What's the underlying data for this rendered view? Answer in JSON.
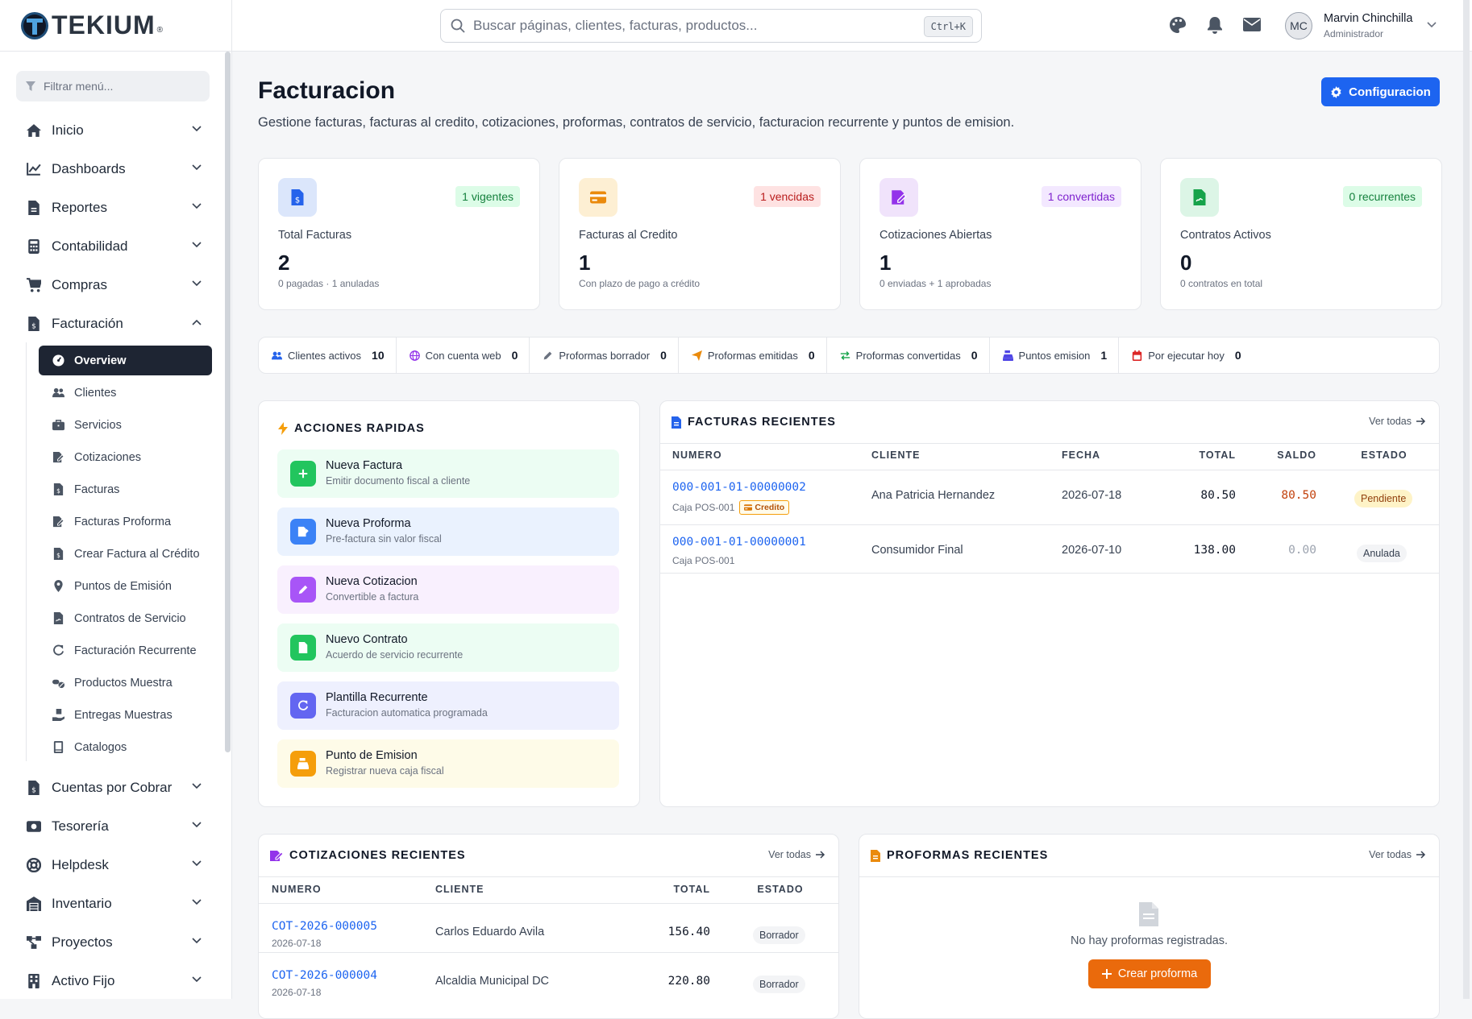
{
  "brand": {
    "logo_text": "TEKIUM",
    "logo_mark": "®"
  },
  "sidebar": {
    "filter_placeholder": "Filtrar menú...",
    "menu": [
      {
        "label": "Inicio",
        "icon": "home-icon"
      },
      {
        "label": "Dashboards",
        "icon": "chart-line-icon"
      },
      {
        "label": "Reportes",
        "icon": "file-icon"
      },
      {
        "label": "Contabilidad",
        "icon": "calculator-icon"
      },
      {
        "label": "Compras",
        "icon": "cart-icon"
      },
      {
        "label": "Facturación",
        "icon": "invoice-icon",
        "expanded": true
      }
    ],
    "submenu": [
      {
        "label": "Overview",
        "icon": "gauge-icon",
        "active": true
      },
      {
        "label": "Clientes",
        "icon": "users-icon"
      },
      {
        "label": "Servicios",
        "icon": "briefcase-icon"
      },
      {
        "label": "Cotizaciones",
        "icon": "edit-file-icon"
      },
      {
        "label": "Facturas",
        "icon": "invoice-icon"
      },
      {
        "label": "Facturas Proforma",
        "icon": "edit-file-icon"
      },
      {
        "label": "Crear Factura al Crédito",
        "icon": "invoice-icon"
      },
      {
        "label": "Puntos de Emisión",
        "icon": "pin-icon"
      },
      {
        "label": "Contratos de Servicio",
        "icon": "contract-icon"
      },
      {
        "label": "Facturación Recurrente",
        "icon": "refresh-icon"
      },
      {
        "label": "Productos Muestra",
        "icon": "pills-icon"
      },
      {
        "label": "Entregas Muestras",
        "icon": "hand-box-icon"
      },
      {
        "label": "Catalogos",
        "icon": "book-icon"
      }
    ],
    "menu_after": [
      {
        "label": "Cuentas por Cobrar",
        "icon": "invoice-icon"
      },
      {
        "label": "Tesorería",
        "icon": "money-icon"
      },
      {
        "label": "Helpdesk",
        "icon": "lifering-icon"
      },
      {
        "label": "Inventario",
        "icon": "warehouse-icon"
      },
      {
        "label": "Proyectos",
        "icon": "diagram-icon"
      },
      {
        "label": "Activo Fijo",
        "icon": "building-icon"
      }
    ]
  },
  "topbar": {
    "search_placeholder": "Buscar páginas, clientes, facturas, productos...",
    "shortcut": "Ctrl+K",
    "user": {
      "initials": "MC",
      "name": "Marvin Chinchilla",
      "role": "Administrador"
    }
  },
  "page": {
    "title": "Facturacion",
    "subtitle": "Gestione facturas, facturas al credito, cotizaciones, proformas, contratos de servicio, facturacion recurrente y puntos de emision.",
    "config_button": "Configuracion"
  },
  "kpis": [
    {
      "label": "Total Facturas",
      "value": "2",
      "note": "0 pagadas · 1 anuladas",
      "badge": "1 vigentes",
      "color": "#2563eb",
      "icon_bg": "#dbe6fb",
      "badge_bg": "#dcfce7",
      "badge_fg": "#15803d"
    },
    {
      "label": "Facturas al Credito",
      "value": "1",
      "note": "Con plazo de pago a crédito",
      "badge": "1 vencidas",
      "color": "#ea8a0c",
      "icon_bg": "#fdefd3",
      "badge_bg": "#fee2e2",
      "badge_fg": "#b91c1c"
    },
    {
      "label": "Cotizaciones Abiertas",
      "value": "1",
      "note": "0 enviadas + 1 aprobadas",
      "badge": "1 convertidas",
      "color": "#9333ea",
      "icon_bg": "#f0e3fb",
      "badge_bg": "#f3e8ff",
      "badge_fg": "#7e22ce"
    },
    {
      "label": "Contratos Activos",
      "value": "0",
      "note": "0 contratos en total",
      "badge": "0 recurrentes",
      "color": "#16a34a",
      "icon_bg": "#dcf5e6",
      "badge_bg": "#dcfce7",
      "badge_fg": "#15803d"
    }
  ],
  "stats": [
    {
      "label": "Clientes activos",
      "value": "10",
      "icon": "users-icon",
      "color": "#2563eb"
    },
    {
      "label": "Con cuenta web",
      "value": "0",
      "icon": "globe-icon",
      "color": "#9333ea"
    },
    {
      "label": "Proformas borrador",
      "value": "0",
      "icon": "pencil-icon",
      "color": "#6b7280"
    },
    {
      "label": "Proformas emitidas",
      "value": "0",
      "icon": "send-icon",
      "color": "#ea8a0c"
    },
    {
      "label": "Proformas convertidas",
      "value": "0",
      "icon": "exchange-icon",
      "color": "#16a34a"
    },
    {
      "label": "Puntos emision",
      "value": "1",
      "icon": "cash-register-icon",
      "color": "#4f46e5"
    },
    {
      "label": "Por ejecutar hoy",
      "value": "0",
      "icon": "calendar-icon",
      "color": "#dc2626"
    }
  ],
  "quick_actions": {
    "title": "ACCIONES RAPIDAS",
    "items": [
      {
        "title": "Nueva Factura",
        "desc": "Emitir documento fiscal a cliente",
        "bg": "#ecfdf3",
        "icon_bg": "#22c55e",
        "icon": "plus-icon"
      },
      {
        "title": "Nueva Proforma",
        "desc": "Pre-factura sin valor fiscal",
        "bg": "#eaf2fe",
        "icon_bg": "#3b82f6",
        "icon": "edit-file-icon"
      },
      {
        "title": "Nueva Cotizacion",
        "desc": "Convertible a factura",
        "bg": "#f9f0fe",
        "icon_bg": "#a855f7",
        "icon": "pen-icon"
      },
      {
        "title": "Nuevo Contrato",
        "desc": "Acuerdo de servicio recurrente",
        "bg": "#ecfdf3",
        "icon_bg": "#22c55e",
        "icon": "contract-icon"
      },
      {
        "title": "Plantilla Recurrente",
        "desc": "Facturacion automatica programada",
        "bg": "#eef0fe",
        "icon_bg": "#6366f1",
        "icon": "refresh-icon"
      },
      {
        "title": "Punto de Emision",
        "desc": "Registrar nueva caja fiscal",
        "bg": "#fefbe8",
        "icon_bg": "#f59e0b",
        "icon": "cash-register-icon"
      }
    ]
  },
  "recent_invoices": {
    "title": "FACTURAS RECIENTES",
    "see_all": "Ver todas",
    "columns": [
      "NUMERO",
      "CLIENTE",
      "FECHA",
      "TOTAL",
      "SALDO",
      "ESTADO"
    ],
    "rows": [
      {
        "numero": "000-001-01-00000002",
        "caja": "Caja POS-001",
        "tag": "Credito",
        "cliente": "Ana Patricia Hernandez",
        "fecha": "2026-07-18",
        "total": "80.50",
        "saldo": "80.50",
        "estado": "Pendiente"
      },
      {
        "numero": "000-001-01-00000001",
        "caja": "Caja POS-001",
        "tag": "",
        "cliente": "Consumidor Final",
        "fecha": "2026-07-10",
        "total": "138.00",
        "saldo": "0.00",
        "estado": "Anulada"
      }
    ]
  },
  "recent_quotes": {
    "title": "COTIZACIONES RECIENTES",
    "see_all": "Ver todas",
    "columns": [
      "NUMERO",
      "CLIENTE",
      "TOTAL",
      "ESTADO"
    ],
    "rows": [
      {
        "numero": "COT-2026-000005",
        "fecha": "2026-07-18",
        "cliente": "Carlos Eduardo Avila",
        "total": "156.40",
        "estado": "Borrador"
      },
      {
        "numero": "COT-2026-000004",
        "fecha": "2026-07-18",
        "cliente": "Alcaldia Municipal DC",
        "total": "220.80",
        "estado": "Borrador"
      }
    ]
  },
  "recent_proformas": {
    "title": "PROFORMAS RECIENTES",
    "see_all": "Ver todas",
    "empty_text": "No hay proformas registradas.",
    "create_button": "Crear proforma"
  }
}
